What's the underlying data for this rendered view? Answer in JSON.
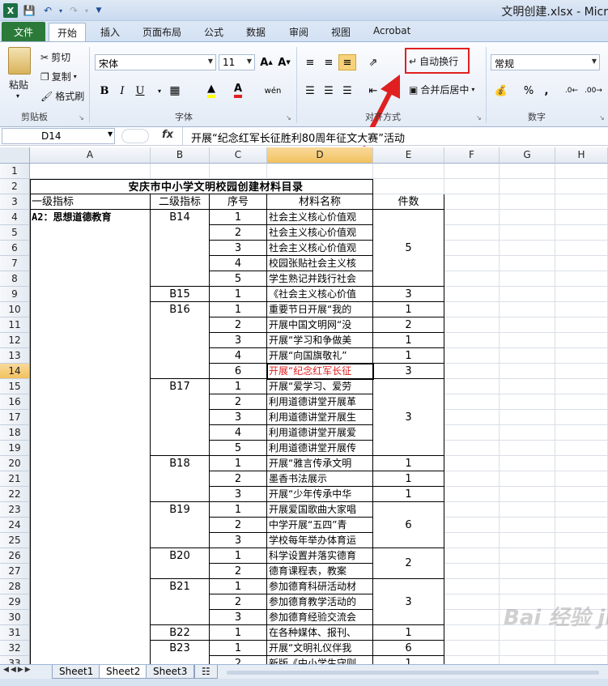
{
  "window": {
    "title": "文明创建.xlsx - Micr"
  },
  "tabs": [
    "文件",
    "开始",
    "插入",
    "页面布局",
    "公式",
    "数据",
    "审阅",
    "视图",
    "Acrobat"
  ],
  "ribbon": {
    "clipboard": {
      "paste": "粘贴",
      "cut": "剪切",
      "copy": "复制",
      "format_painter": "格式刷",
      "label": "剪贴板"
    },
    "font": {
      "name": "宋体",
      "size": "11",
      "bold": "B",
      "italic": "I",
      "underline": "U",
      "label": "字体"
    },
    "alignment": {
      "wrap_text": "自动换行",
      "merge_center": "合并后居中",
      "label": "对齐方式"
    },
    "number": {
      "format": "常规",
      "percent": "%",
      "label": "数字"
    }
  },
  "formula_bar": {
    "name_box": "D14",
    "fx": "fx",
    "content": "开展“纪念红军长征胜利80周年征文大赛”活动"
  },
  "columns": [
    "A",
    "B",
    "C",
    "D",
    "E",
    "F",
    "G",
    "H"
  ],
  "selected": {
    "col": "D",
    "row": "14"
  },
  "sheet": {
    "title": "安庆市中小学文明校园创建材料目录",
    "headers": [
      "一级指标",
      "二级指标",
      "序号",
      "材料名称",
      "件数"
    ],
    "rows": [
      {
        "r": "4",
        "a": "A2：思想道德教育",
        "b": "B14",
        "c": "1",
        "d": "社会主义核心价值观"
      },
      {
        "r": "5",
        "a": "",
        "b": "",
        "c": "2",
        "d": "社会主义核心价值观"
      },
      {
        "r": "6",
        "a": "",
        "b": "",
        "c": "3",
        "d": "社会主义核心价值观"
      },
      {
        "r": "7",
        "a": "",
        "b": "",
        "c": "4",
        "d": "校园张贴社会主义核"
      },
      {
        "r": "8",
        "a": "",
        "b": "",
        "c": "5",
        "d": "学生熟记并践行社会"
      },
      {
        "r": "9",
        "a": "",
        "b": "B15",
        "c": "1",
        "d": "《社会主义核心价值"
      },
      {
        "r": "10",
        "a": "",
        "b": "B16",
        "c": "1",
        "d": "重要节日开展“我的"
      },
      {
        "r": "11",
        "a": "",
        "b": "",
        "c": "2",
        "d": "开展中国文明网“没"
      },
      {
        "r": "12",
        "a": "",
        "b": "",
        "c": "3",
        "d": "开展“学习和争做美"
      },
      {
        "r": "13",
        "a": "",
        "b": "",
        "c": "4",
        "d": "开展“向国旗敬礼”"
      },
      {
        "r": "14",
        "a": "",
        "b": "",
        "c": "6",
        "d": "开展“纪念红军长征"
      },
      {
        "r": "15",
        "a": "",
        "b": "B17",
        "c": "1",
        "d": "开展“爱学习、爱劳"
      },
      {
        "r": "16",
        "a": "",
        "b": "",
        "c": "2",
        "d": "利用道德讲堂开展革"
      },
      {
        "r": "17",
        "a": "",
        "b": "",
        "c": "3",
        "d": "利用道德讲堂开展生"
      },
      {
        "r": "18",
        "a": "",
        "b": "",
        "c": "4",
        "d": "利用道德讲堂开展爱"
      },
      {
        "r": "19",
        "a": "",
        "b": "",
        "c": "5",
        "d": "利用道德讲堂开展传"
      },
      {
        "r": "20",
        "a": "",
        "b": "B18",
        "c": "1",
        "d": "开展“雅言传承文明"
      },
      {
        "r": "21",
        "a": "",
        "b": "",
        "c": "2",
        "d": "墨香书法展示"
      },
      {
        "r": "22",
        "a": "",
        "b": "",
        "c": "3",
        "d": "开展“少年传承中华"
      },
      {
        "r": "23",
        "a": "",
        "b": "B19",
        "c": "1",
        "d": "开展爱国歌曲大家唱"
      },
      {
        "r": "24",
        "a": "",
        "b": "",
        "c": "2",
        "d": "中学开展“五四”青"
      },
      {
        "r": "25",
        "a": "",
        "b": "",
        "c": "3",
        "d": "学校每年举办体育运"
      },
      {
        "r": "26",
        "a": "",
        "b": "B20",
        "c": "1",
        "d": "科学设置并落实德育"
      },
      {
        "r": "27",
        "a": "",
        "b": "",
        "c": "2",
        "d": "德育课程表，教案"
      },
      {
        "r": "28",
        "a": "",
        "b": "B21",
        "c": "1",
        "d": "参加德育科研活动材"
      },
      {
        "r": "29",
        "a": "",
        "b": "",
        "c": "2",
        "d": "参加德育教学活动的"
      },
      {
        "r": "30",
        "a": "",
        "b": "",
        "c": "3",
        "d": "参加德育经验交流会"
      },
      {
        "r": "31",
        "a": "",
        "b": "B22",
        "c": "1",
        "d": "在各种媒体、报刊、"
      },
      {
        "r": "32",
        "a": "",
        "b": "B23",
        "c": "1",
        "d": "开展“文明礼仪伴我"
      },
      {
        "r": "33",
        "a": "",
        "b": "",
        "c": "2",
        "d": "新版《中小学生守则"
      }
    ],
    "counts": [
      {
        "from": 4,
        "to": 8,
        "v": "5"
      },
      {
        "from": 9,
        "to": 9,
        "v": "3"
      },
      {
        "from": 10,
        "to": 10,
        "v": "1"
      },
      {
        "from": 11,
        "to": 11,
        "v": "2"
      },
      {
        "from": 12,
        "to": 12,
        "v": "1"
      },
      {
        "from": 13,
        "to": 13,
        "v": "1"
      },
      {
        "from": 14,
        "to": 14,
        "v": "3"
      },
      {
        "from": 15,
        "to": 19,
        "v": "3"
      },
      {
        "from": 20,
        "to": 20,
        "v": "1"
      },
      {
        "from": 21,
        "to": 21,
        "v": "1"
      },
      {
        "from": 22,
        "to": 22,
        "v": "1"
      },
      {
        "from": 23,
        "to": 25,
        "v": "6"
      },
      {
        "from": 26,
        "to": 27,
        "v": "2"
      },
      {
        "from": 28,
        "to": 30,
        "v": "3"
      },
      {
        "from": 31,
        "to": 31,
        "v": "1"
      },
      {
        "from": 32,
        "to": 32,
        "v": "6"
      },
      {
        "from": 33,
        "to": 33,
        "v": "1"
      }
    ]
  },
  "sheet_tabs": [
    "Sheet1",
    "Sheet2",
    "Sheet3"
  ],
  "active_sheet": "Sheet2",
  "watermark": "Bai 经验 jingyan.baidu.com"
}
